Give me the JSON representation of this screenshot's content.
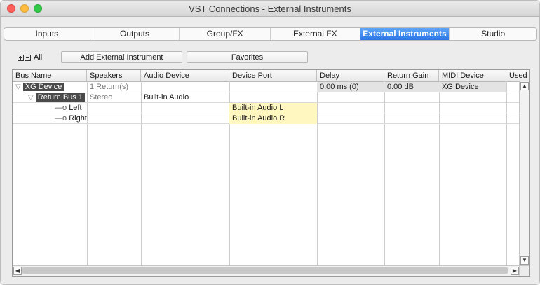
{
  "window": {
    "title": "VST Connections - External Instruments"
  },
  "tabs": [
    {
      "label": "Inputs",
      "active": false
    },
    {
      "label": "Outputs",
      "active": false
    },
    {
      "label": "Group/FX",
      "active": false
    },
    {
      "label": "External FX",
      "active": false
    },
    {
      "label": "External Instruments",
      "active": true
    },
    {
      "label": "Studio",
      "active": false
    }
  ],
  "toolbar": {
    "all_label": "All",
    "add_button": "Add External Instrument",
    "favorites_button": "Favorites"
  },
  "table": {
    "columns": [
      "Bus Name",
      "Speakers",
      "Audio Device",
      "Device Port",
      "Delay",
      "Return Gain",
      "MIDI Device",
      "Used"
    ],
    "rows": [
      {
        "bus_name": "XG Device",
        "speakers": "1 Return(s)",
        "audio_device": "",
        "device_port": "",
        "delay": "0.00 ms (0)",
        "return_gain": "0.00 dB",
        "midi_device": "XG Device",
        "used": ""
      },
      {
        "bus_name": "Return Bus 1",
        "speakers": "Stereo",
        "audio_device": "Built-in Audio",
        "device_port": "",
        "delay": "",
        "return_gain": "",
        "midi_device": "",
        "used": ""
      },
      {
        "bus_name": "Left",
        "speakers": "",
        "audio_device": "",
        "device_port": "Built-in Audio L",
        "delay": "",
        "return_gain": "",
        "midi_device": "",
        "used": ""
      },
      {
        "bus_name": "Right",
        "speakers": "",
        "audio_device": "",
        "device_port": "Built-in Audio R",
        "delay": "",
        "return_gain": "",
        "midi_device": "",
        "used": ""
      }
    ]
  },
  "icons": {
    "tree_collapse": "▽",
    "connector": "—o",
    "scroll_up": "▲",
    "scroll_down": "▼",
    "scroll_left": "◀",
    "scroll_right": "▶"
  },
  "colors": {
    "accent": "#2a76e6",
    "port_highlight": "#fff6c0"
  }
}
